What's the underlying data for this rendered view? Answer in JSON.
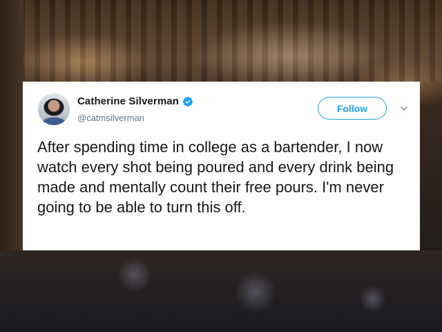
{
  "tweet": {
    "display_name": "Catherine Silverman",
    "handle": "@catmsilverman",
    "verified": true,
    "follow_label": "Follow",
    "text": "After spending time in college as a bartender, I now watch every shot being poured and every drink being made and mentally count their free pours. I'm never going to be able to turn this off."
  },
  "icons": {
    "verified": "verified-badge-icon",
    "more": "chevron-down-icon"
  },
  "colors": {
    "accent": "#1da1f2",
    "text": "#14171a",
    "secondary_text": "#657786"
  }
}
